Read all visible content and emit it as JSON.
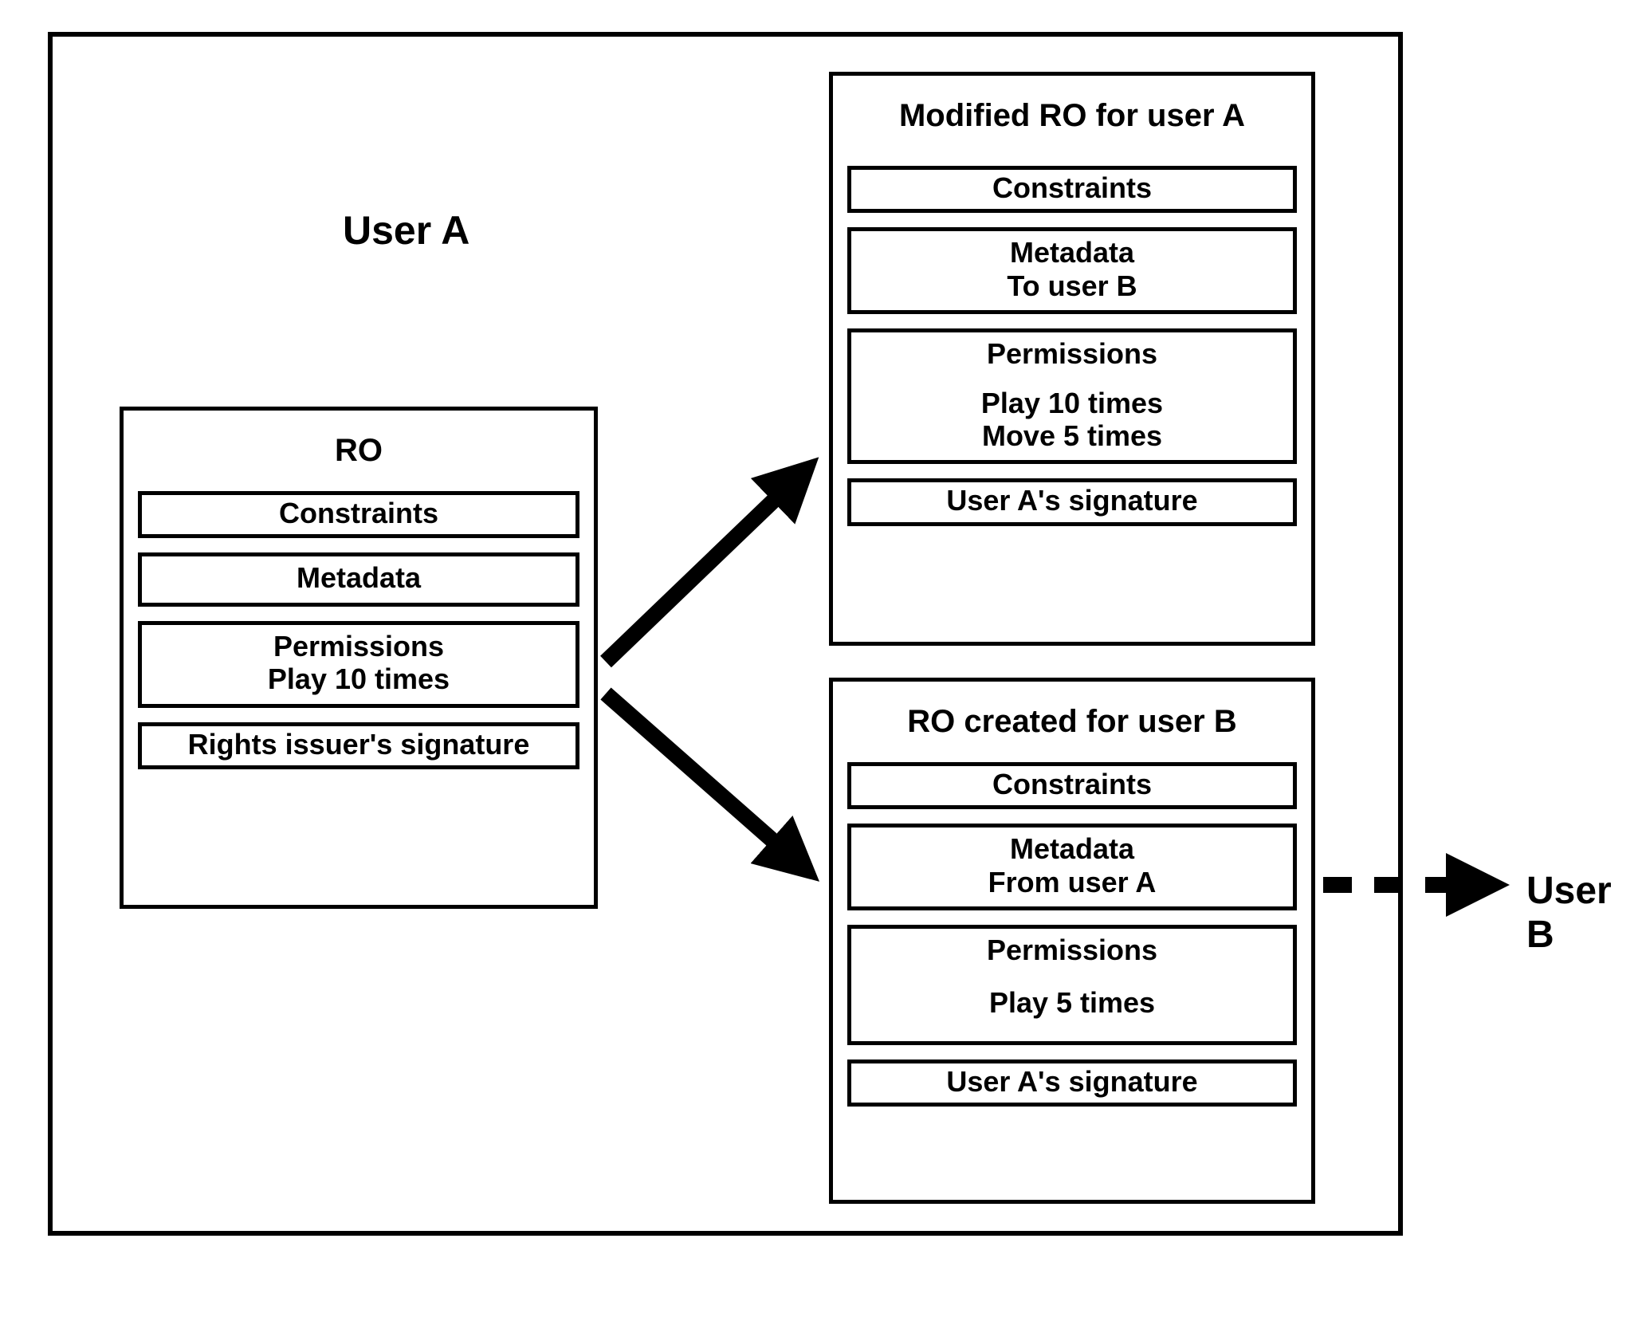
{
  "labels": {
    "user_a": "User A",
    "user_b": "User B"
  },
  "box_a": {
    "title": "RO",
    "constraints": "Constraints",
    "metadata": "Metadata",
    "permissions_title": "Permissions",
    "permissions_line1": "Play 10 times",
    "signature": "Rights issuer's signature"
  },
  "box_b": {
    "title": "Modified RO for user A",
    "constraints": "Constraints",
    "metadata_title": "Metadata",
    "metadata_line1": "To user B",
    "permissions_title": "Permissions",
    "permissions_line1": "Play 10 times",
    "permissions_line2": "Move 5 times",
    "signature": "User A's signature"
  },
  "box_c": {
    "title": "RO created for user B",
    "constraints": "Constraints",
    "metadata_title": "Metadata",
    "metadata_line1": "From user A",
    "permissions_title": "Permissions",
    "permissions_line1": "Play 5 times",
    "signature": "User A's signature"
  }
}
